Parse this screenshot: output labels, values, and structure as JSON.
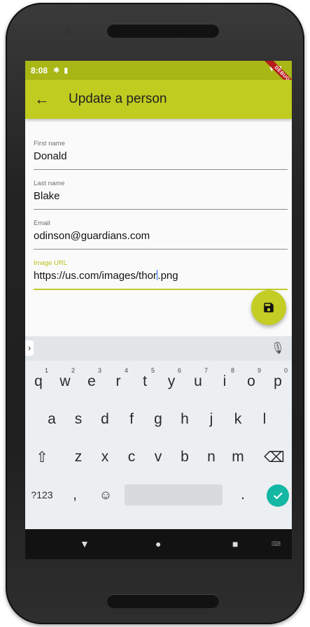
{
  "status_bar": {
    "time": "8:08",
    "debug_label": "DEBUG"
  },
  "app_bar": {
    "title": "Update a person"
  },
  "form": {
    "fields": [
      {
        "label": "First name",
        "value": "Donald"
      },
      {
        "label": "Last name",
        "value": "Blake"
      },
      {
        "label": "Email",
        "value": "odinson@guardians.com"
      },
      {
        "label": "Image URL",
        "value_before_cursor": "https://us.com/images/thor",
        "value_after_cursor": ".png"
      }
    ]
  },
  "keyboard": {
    "row1": [
      {
        "key": "q",
        "hint": "1"
      },
      {
        "key": "w",
        "hint": "2"
      },
      {
        "key": "e",
        "hint": "3"
      },
      {
        "key": "r",
        "hint": "4"
      },
      {
        "key": "t",
        "hint": "5"
      },
      {
        "key": "y",
        "hint": "6"
      },
      {
        "key": "u",
        "hint": "7"
      },
      {
        "key": "i",
        "hint": "8"
      },
      {
        "key": "o",
        "hint": "9"
      },
      {
        "key": "p",
        "hint": "0"
      }
    ],
    "row2": [
      "a",
      "s",
      "d",
      "f",
      "g",
      "h",
      "j",
      "k",
      "l"
    ],
    "row3": [
      "z",
      "x",
      "c",
      "v",
      "b",
      "n",
      "m"
    ],
    "symbols_label": "?123",
    "comma": ",",
    "period": "."
  },
  "colors": {
    "primary": "#c0cc1f",
    "status_bar": "#a8b716",
    "accent": "#14b6a4"
  }
}
